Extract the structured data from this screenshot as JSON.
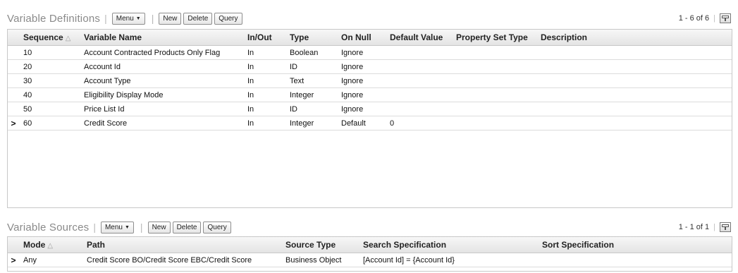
{
  "definitions": {
    "title": "Variable Definitions",
    "menu_label": "Menu",
    "new_label": "New",
    "delete_label": "Delete",
    "query_label": "Query",
    "count": "1 - 6 of 6",
    "columns": [
      "Sequence",
      "Variable Name",
      "In/Out",
      "Type",
      "On Null",
      "Default Value",
      "Property Set Type",
      "Description"
    ],
    "rows": [
      {
        "indicator": "",
        "seq": "10",
        "name": "Account Contracted Products Only Flag",
        "inout": "In",
        "type": "Boolean",
        "onnull": "Ignore",
        "default": "",
        "pst": "",
        "desc": ""
      },
      {
        "indicator": "",
        "seq": "20",
        "name": "Account Id",
        "inout": "In",
        "type": "ID",
        "onnull": "Ignore",
        "default": "",
        "pst": "",
        "desc": ""
      },
      {
        "indicator": "",
        "seq": "30",
        "name": "Account Type",
        "inout": "In",
        "type": "Text",
        "onnull": "Ignore",
        "default": "",
        "pst": "",
        "desc": ""
      },
      {
        "indicator": "",
        "seq": "40",
        "name": "Eligibility Display Mode",
        "inout": "In",
        "type": "Integer",
        "onnull": "Ignore",
        "default": "",
        "pst": "",
        "desc": ""
      },
      {
        "indicator": "",
        "seq": "50",
        "name": "Price List Id",
        "inout": "In",
        "type": "ID",
        "onnull": "Ignore",
        "default": "",
        "pst": "",
        "desc": ""
      },
      {
        "indicator": ">",
        "seq": "60",
        "name": "Credit Score",
        "inout": "In",
        "type": "Integer",
        "onnull": "Default",
        "default": "0",
        "pst": "",
        "desc": ""
      }
    ]
  },
  "sources": {
    "title": "Variable Sources",
    "menu_label": "Menu",
    "new_label": "New",
    "delete_label": "Delete",
    "query_label": "Query",
    "count": "1 - 1 of 1",
    "columns": [
      "Mode",
      "Path",
      "Source Type",
      "Search Specification",
      "Sort Specification"
    ],
    "rows": [
      {
        "indicator": ">",
        "mode": "Any",
        "path": "Credit Score BO/Credit Score EBC/Credit Score",
        "stype": "Business Object",
        "search": "[Account Id] = {Account Id}",
        "sort": ""
      }
    ]
  },
  "icons": {
    "menu_caret": "caret-down-icon",
    "sort": "sort-ascending-icon",
    "config": "column-config-icon",
    "row_indicator": "current-row-chevron-icon"
  }
}
